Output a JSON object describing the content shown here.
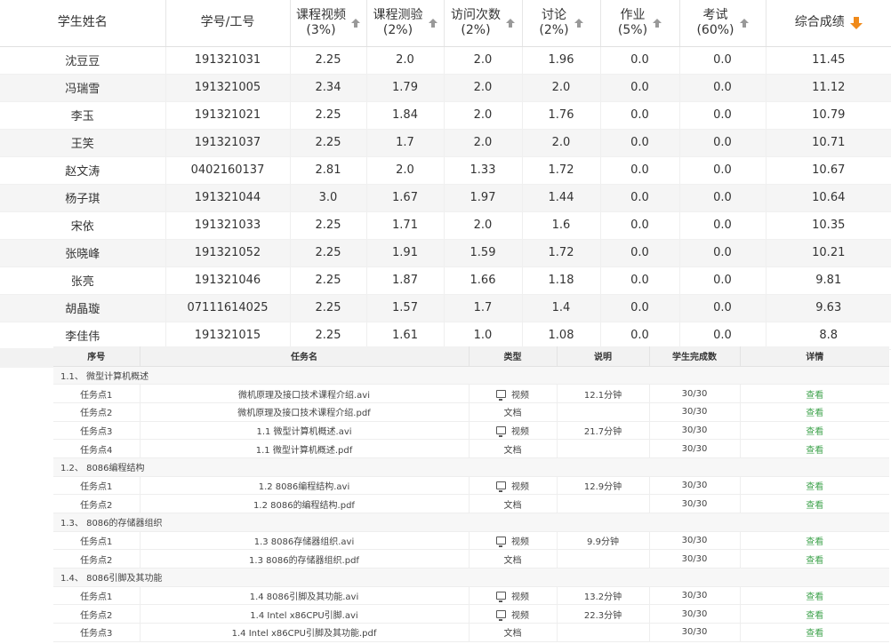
{
  "grades": {
    "headers": [
      {
        "label": "学生姓名",
        "sort": "none"
      },
      {
        "label": "学号/工号",
        "sort": "none"
      },
      {
        "label": "课程视频\n(3%)",
        "sort": "up"
      },
      {
        "label": "课程测验\n(2%)",
        "sort": "up"
      },
      {
        "label": "访问次数\n(2%)",
        "sort": "up"
      },
      {
        "label": "讨论\n(2%)",
        "sort": "up"
      },
      {
        "label": "作业\n(5%)",
        "sort": "up"
      },
      {
        "label": "考试\n(60%)",
        "sort": "up"
      },
      {
        "label": "综合成绩",
        "sort": "down"
      }
    ],
    "rows": [
      [
        "沈豆豆",
        "191321031",
        "2.25",
        "2.0",
        "2.0",
        "1.96",
        "0.0",
        "0.0",
        "11.45"
      ],
      [
        "冯瑞雪",
        "191321005",
        "2.34",
        "1.79",
        "2.0",
        "2.0",
        "0.0",
        "0.0",
        "11.12"
      ],
      [
        "李玉",
        "191321021",
        "2.25",
        "1.84",
        "2.0",
        "1.76",
        "0.0",
        "0.0",
        "10.79"
      ],
      [
        "王笑",
        "191321037",
        "2.25",
        "1.7",
        "2.0",
        "2.0",
        "0.0",
        "0.0",
        "10.71"
      ],
      [
        "赵文涛",
        "0402160137",
        "2.81",
        "2.0",
        "1.33",
        "1.72",
        "0.0",
        "0.0",
        "10.67"
      ],
      [
        "杨子琪",
        "191321044",
        "3.0",
        "1.67",
        "1.97",
        "1.44",
        "0.0",
        "0.0",
        "10.64"
      ],
      [
        "宋依",
        "191321033",
        "2.25",
        "1.71",
        "2.0",
        "1.6",
        "0.0",
        "0.0",
        "10.35"
      ],
      [
        "张晓峰",
        "191321052",
        "2.25",
        "1.91",
        "1.59",
        "1.72",
        "0.0",
        "0.0",
        "10.21"
      ],
      [
        "张亮",
        "191321046",
        "2.25",
        "1.87",
        "1.66",
        "1.18",
        "0.0",
        "0.0",
        "9.81"
      ],
      [
        "胡晶璇",
        "07111614025",
        "2.25",
        "1.57",
        "1.7",
        "1.4",
        "0.0",
        "0.0",
        "9.63"
      ],
      [
        "李佳伟",
        "191321015",
        "2.25",
        "1.61",
        "1.0",
        "1.08",
        "0.0",
        "0.0",
        "8.8"
      ]
    ]
  },
  "tasks": {
    "headers": [
      "序号",
      "任务名",
      "类型",
      "说明",
      "学生完成数",
      "详情"
    ],
    "sections": [
      {
        "title": "1.1、 微型计算机概述",
        "items": [
          {
            "index": "任务点1",
            "name": "微机原理及接口技术课程介绍.avi",
            "type": "视频",
            "icon": "monitor-icon",
            "note": "12.1分钟",
            "done": "30/30",
            "detail": "查看"
          },
          {
            "index": "任务点2",
            "name": "微机原理及接口技术课程介绍.pdf",
            "type": "文档",
            "icon": "",
            "note": "",
            "done": "30/30",
            "detail": "查看"
          },
          {
            "index": "任务点3",
            "name": "1.1 微型计算机概述.avi",
            "type": "视频",
            "icon": "monitor-icon",
            "note": "21.7分钟",
            "done": "30/30",
            "detail": "查看"
          },
          {
            "index": "任务点4",
            "name": "1.1 微型计算机概述.pdf",
            "type": "文档",
            "icon": "",
            "note": "",
            "done": "30/30",
            "detail": "查看"
          }
        ]
      },
      {
        "title": "1.2、 8086编程结构",
        "items": [
          {
            "index": "任务点1",
            "name": "1.2 8086编程结构.avi",
            "type": "视频",
            "icon": "monitor-icon",
            "note": "12.9分钟",
            "done": "30/30",
            "detail": "查看"
          },
          {
            "index": "任务点2",
            "name": "1.2 8086的编程结构.pdf",
            "type": "文档",
            "icon": "",
            "note": "",
            "done": "30/30",
            "detail": "查看"
          }
        ]
      },
      {
        "title": "1.3、 8086的存储器组织",
        "items": [
          {
            "index": "任务点1",
            "name": "1.3 8086存储器组织.avi",
            "type": "视频",
            "icon": "monitor-icon",
            "note": "9.9分钟",
            "done": "30/30",
            "detail": "查看"
          },
          {
            "index": "任务点2",
            "name": "1.3 8086的存储器组织.pdf",
            "type": "文档",
            "icon": "",
            "note": "",
            "done": "30/30",
            "detail": "查看"
          }
        ]
      },
      {
        "title": "1.4、 8086引脚及其功能",
        "items": [
          {
            "index": "任务点1",
            "name": "1.4 8086引脚及其功能.avi",
            "type": "视频",
            "icon": "monitor-icon",
            "note": "13.2分钟",
            "done": "30/30",
            "detail": "查看"
          },
          {
            "index": "任务点2",
            "name": "1.4 Intel x86CPU引脚.avi",
            "type": "视频",
            "icon": "monitor-icon",
            "note": "22.3分钟",
            "done": "30/30",
            "detail": "查看"
          },
          {
            "index": "任务点3",
            "name": "1.4 Intel x86CPU引脚及其功能.pdf",
            "type": "文档",
            "icon": "",
            "note": "",
            "done": "30/30",
            "detail": "查看"
          }
        ]
      }
    ]
  }
}
